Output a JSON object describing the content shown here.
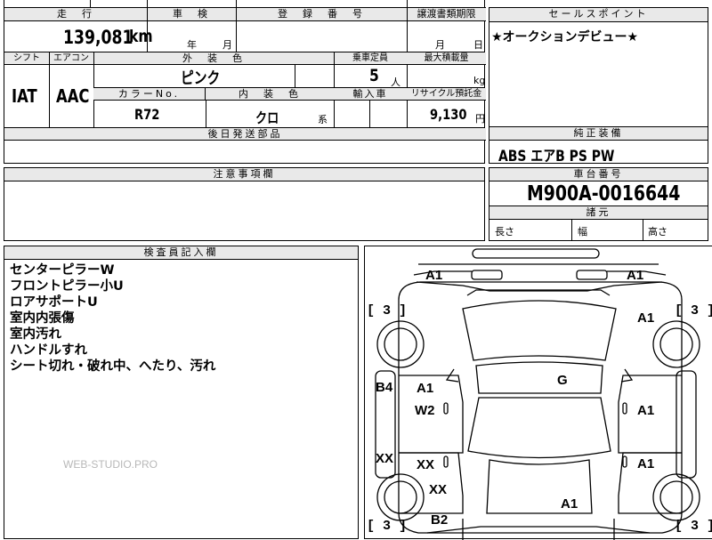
{
  "top_row": {
    "mileage_header": "走　行",
    "mileage_value": "139,081",
    "mileage_unit": "km",
    "inspection_header": "車　検",
    "inspection_year": "年",
    "inspection_month": "月",
    "registration_header": "登　録　番　号",
    "transfer_header": "譲渡書類期限",
    "transfer_month": "月",
    "transfer_day": "日"
  },
  "sales_point": {
    "header": "セールスポイント",
    "text": "★オークションデビュー★"
  },
  "spec": {
    "shift_header": "シフト",
    "shift_value": "IAT",
    "ac_header": "エアコン",
    "ac_value": "AAC",
    "exterior_header": "外　装　色",
    "exterior_value": "ピンク",
    "seating_header": "乗車定員",
    "seating_value": "5",
    "seating_unit": "人",
    "load_header": "最大積載量",
    "load_unit": "kg",
    "color_no_header": "カラーNo.",
    "color_no_value": "R72",
    "interior_header": "内　装　色",
    "interior_value": "クロ",
    "interior_suffix": "系",
    "import_header": "輸入車",
    "recycle_header": "リサイクル預託金",
    "recycle_value": "9,130",
    "recycle_unit": "円"
  },
  "parts": {
    "header": "後日発送部品"
  },
  "equipment": {
    "header": "純正装備",
    "value": "ABS エアB PS PW"
  },
  "notes": {
    "header": "注意事項欄"
  },
  "chassis": {
    "header": "車台番号",
    "value": "M900A-0016644"
  },
  "dimensions": {
    "header": "諸元",
    "length": "長さ",
    "width": "幅",
    "height": "高さ"
  },
  "inspector": {
    "header": "検査員記入欄",
    "lines": [
      "センターピラーW",
      "フロントピラー小U",
      "ロアサポートU",
      "室内内張傷",
      "室内汚れ",
      "ハンドルすれ",
      "シート切れ・破れ中、へたり、汚れ"
    ],
    "watermark": "WEB-STUDIO.PRO"
  },
  "diagram": {
    "marks": {
      "front_left": "A1",
      "front_right": "A1",
      "front_right_fender": "A1",
      "roof": "G",
      "left_front_door": "A1",
      "left_front_door_b": "W2",
      "right_front_door": "A1",
      "left_sill": "B4",
      "left_rear_sill": "XX",
      "left_rear_door": "XX",
      "right_rear_door": "A1",
      "left_rear_fender": "XX",
      "rear_left": "B2",
      "rear_right": "A1"
    },
    "tire_labels": {
      "front_left": "[ 3 ]",
      "front_right": "[ 3 ]",
      "rear_left": "[ 3 ]",
      "rear_right": "[ 3 ]"
    }
  }
}
